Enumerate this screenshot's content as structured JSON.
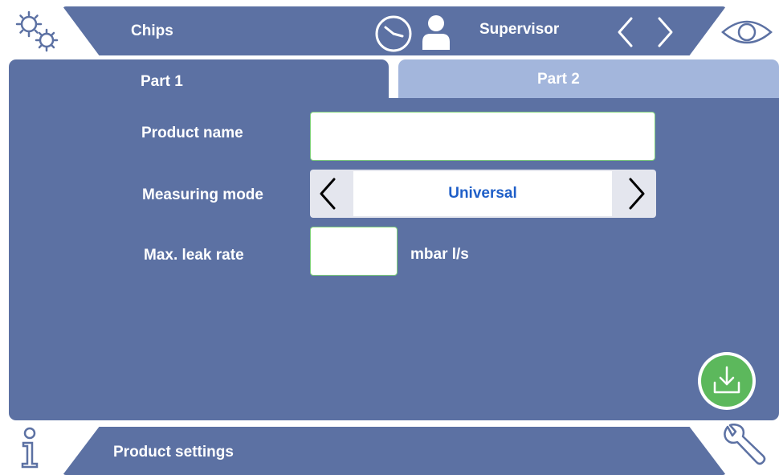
{
  "header": {
    "title": "Chips",
    "user": "Supervisor"
  },
  "tabs": [
    {
      "label": "Part 1",
      "active": true
    },
    {
      "label": "Part 2",
      "active": false
    }
  ],
  "form": {
    "product_name": {
      "label": "Product name",
      "value": ""
    },
    "measuring_mode": {
      "label": "Measuring mode",
      "value": "Universal"
    },
    "max_leak_rate": {
      "label": "Max. leak rate",
      "value": "",
      "unit": "mbar l/s"
    }
  },
  "footer": {
    "title": "Product settings"
  },
  "icons": {
    "settings": "gears-icon",
    "clock": "clock-icon",
    "user": "user-icon",
    "prev": "chevron-left-icon",
    "next": "chevron-right-icon",
    "view": "eye-icon",
    "info": "info-icon",
    "tools": "wrench-icon",
    "save": "download-icon"
  },
  "colors": {
    "panel": "#5c71a3",
    "tab_inactive": "#a3b6dc",
    "accent_green": "#5cb85c",
    "value_blue": "#1f5fc8"
  }
}
